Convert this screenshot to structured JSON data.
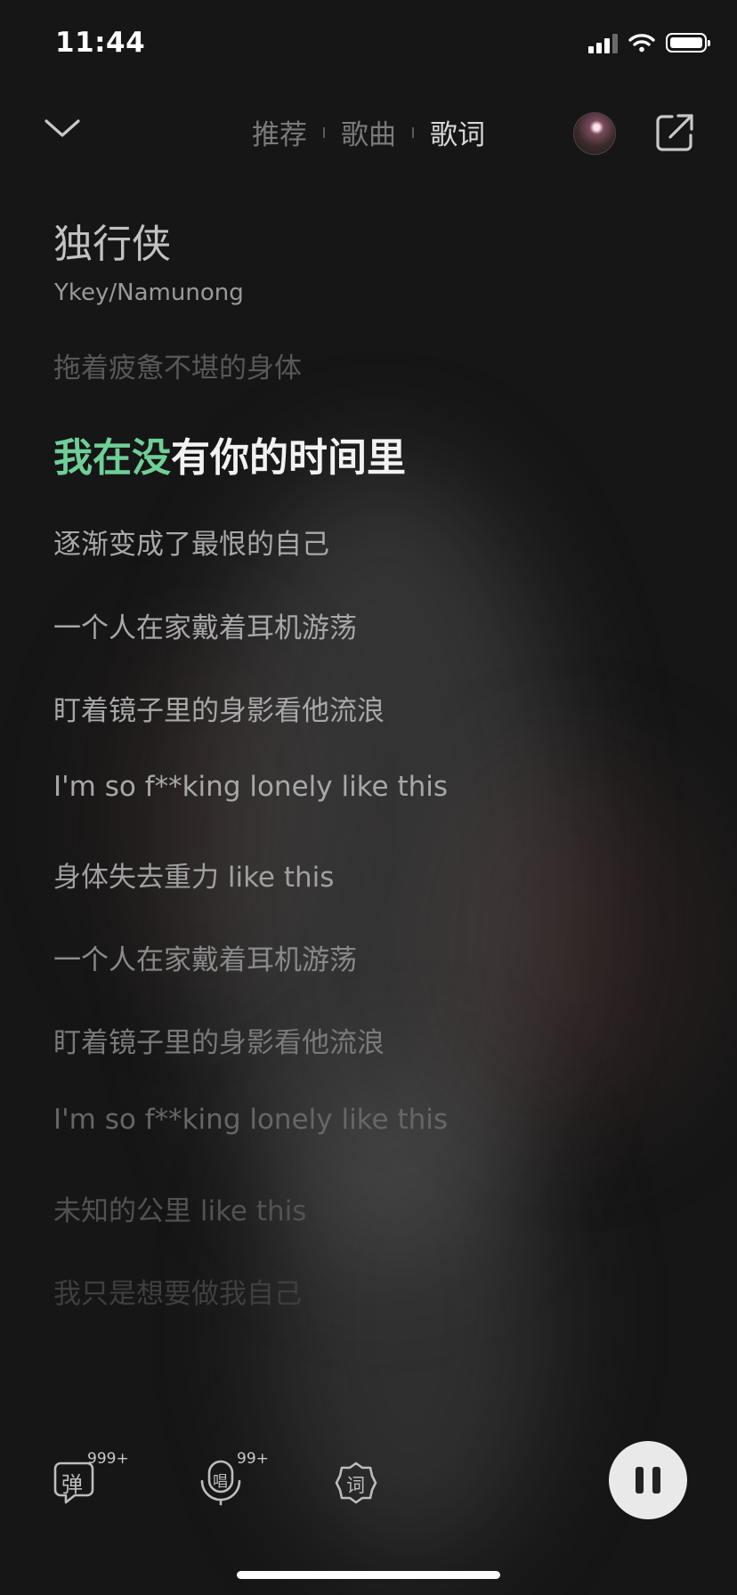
{
  "status_bar": {
    "time": "11:44"
  },
  "header": {
    "tabs": [
      {
        "label": "推荐",
        "active": false
      },
      {
        "label": "歌曲",
        "active": false
      },
      {
        "label": "歌词",
        "active": true
      }
    ]
  },
  "song": {
    "title": "独行侠",
    "artist": "Ykey/Namunong"
  },
  "lyrics": {
    "current_index": 1,
    "current_sung": "我在没",
    "current_rest": "有你的时间里",
    "lines": [
      "拖着疲惫不堪的身体",
      "我在没有你的时间里",
      "逐渐变成了最恨的自己",
      "一个人在家戴着耳机游荡",
      "盯着镜子里的身影看他流浪",
      "I'm so f**king lonely like this",
      "身体失去重力 like this",
      "一个人在家戴着耳机游荡",
      "盯着镜子里的身影看他流浪",
      "I'm so f**king lonely like this",
      "未知的公里 like this",
      "我只是想要做我自己"
    ]
  },
  "toolbar": {
    "danmu_icon_char": "弹",
    "danmu_count": "999+",
    "sing_icon_char": "唱",
    "sing_count": "99+",
    "lyric_icon_char": "词"
  },
  "colors": {
    "accent_sung": "#6fcf97",
    "background": "#161616"
  },
  "icons": [
    "chevron-down-icon",
    "share-icon",
    "pause-icon",
    "danmu-icon",
    "microphone-icon",
    "lyrics-badge-icon"
  ]
}
